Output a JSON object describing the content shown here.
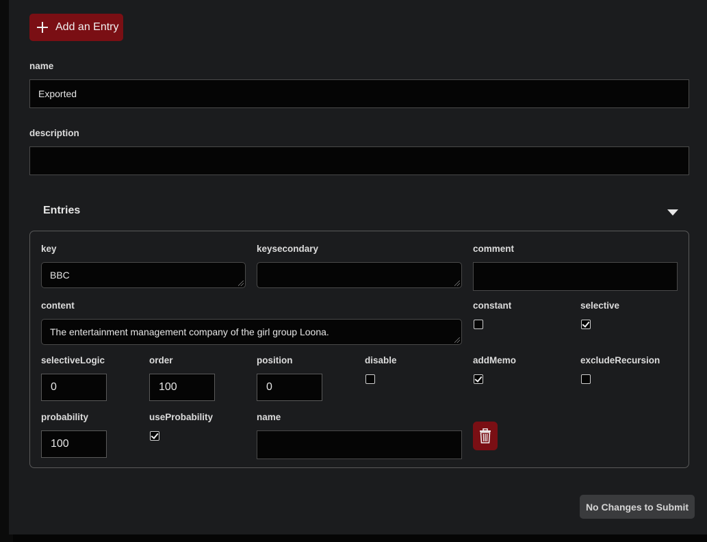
{
  "toolbar": {
    "add_entry_label": "Add an Entry"
  },
  "form": {
    "name_label": "name",
    "name_value": "Exported",
    "description_label": "description",
    "description_value": ""
  },
  "entries": {
    "title": "Entries",
    "entry": {
      "key_label": "key",
      "key_value": "BBC",
      "keysecondary_label": "keysecondary",
      "keysecondary_value": "",
      "comment_label": "comment",
      "comment_value": "",
      "content_label": "content",
      "content_value": "The entertainment management company of the girl group Loona.",
      "constant_label": "constant",
      "constant_checked": false,
      "selective_label": "selective",
      "selective_checked": true,
      "selectiveLogic_label": "selectiveLogic",
      "selectiveLogic_value": "0",
      "order_label": "order",
      "order_value": "100",
      "position_label": "position",
      "position_value": "0",
      "disable_label": "disable",
      "disable_checked": false,
      "addMemo_label": "addMemo",
      "addMemo_checked": true,
      "excludeRecursion_label": "excludeRecursion",
      "excludeRecursion_checked": false,
      "probability_label": "probability",
      "probability_value": "100",
      "useProbability_label": "useProbability",
      "useProbability_checked": true,
      "name_label": "name",
      "name_value": "",
      "delete_icon": "trash-icon"
    }
  },
  "footer": {
    "submit_label": "No Changes to Submit"
  },
  "colors": {
    "accent": "#7a0f14",
    "background": "#1b1c1e",
    "input_bg": "#050505"
  }
}
